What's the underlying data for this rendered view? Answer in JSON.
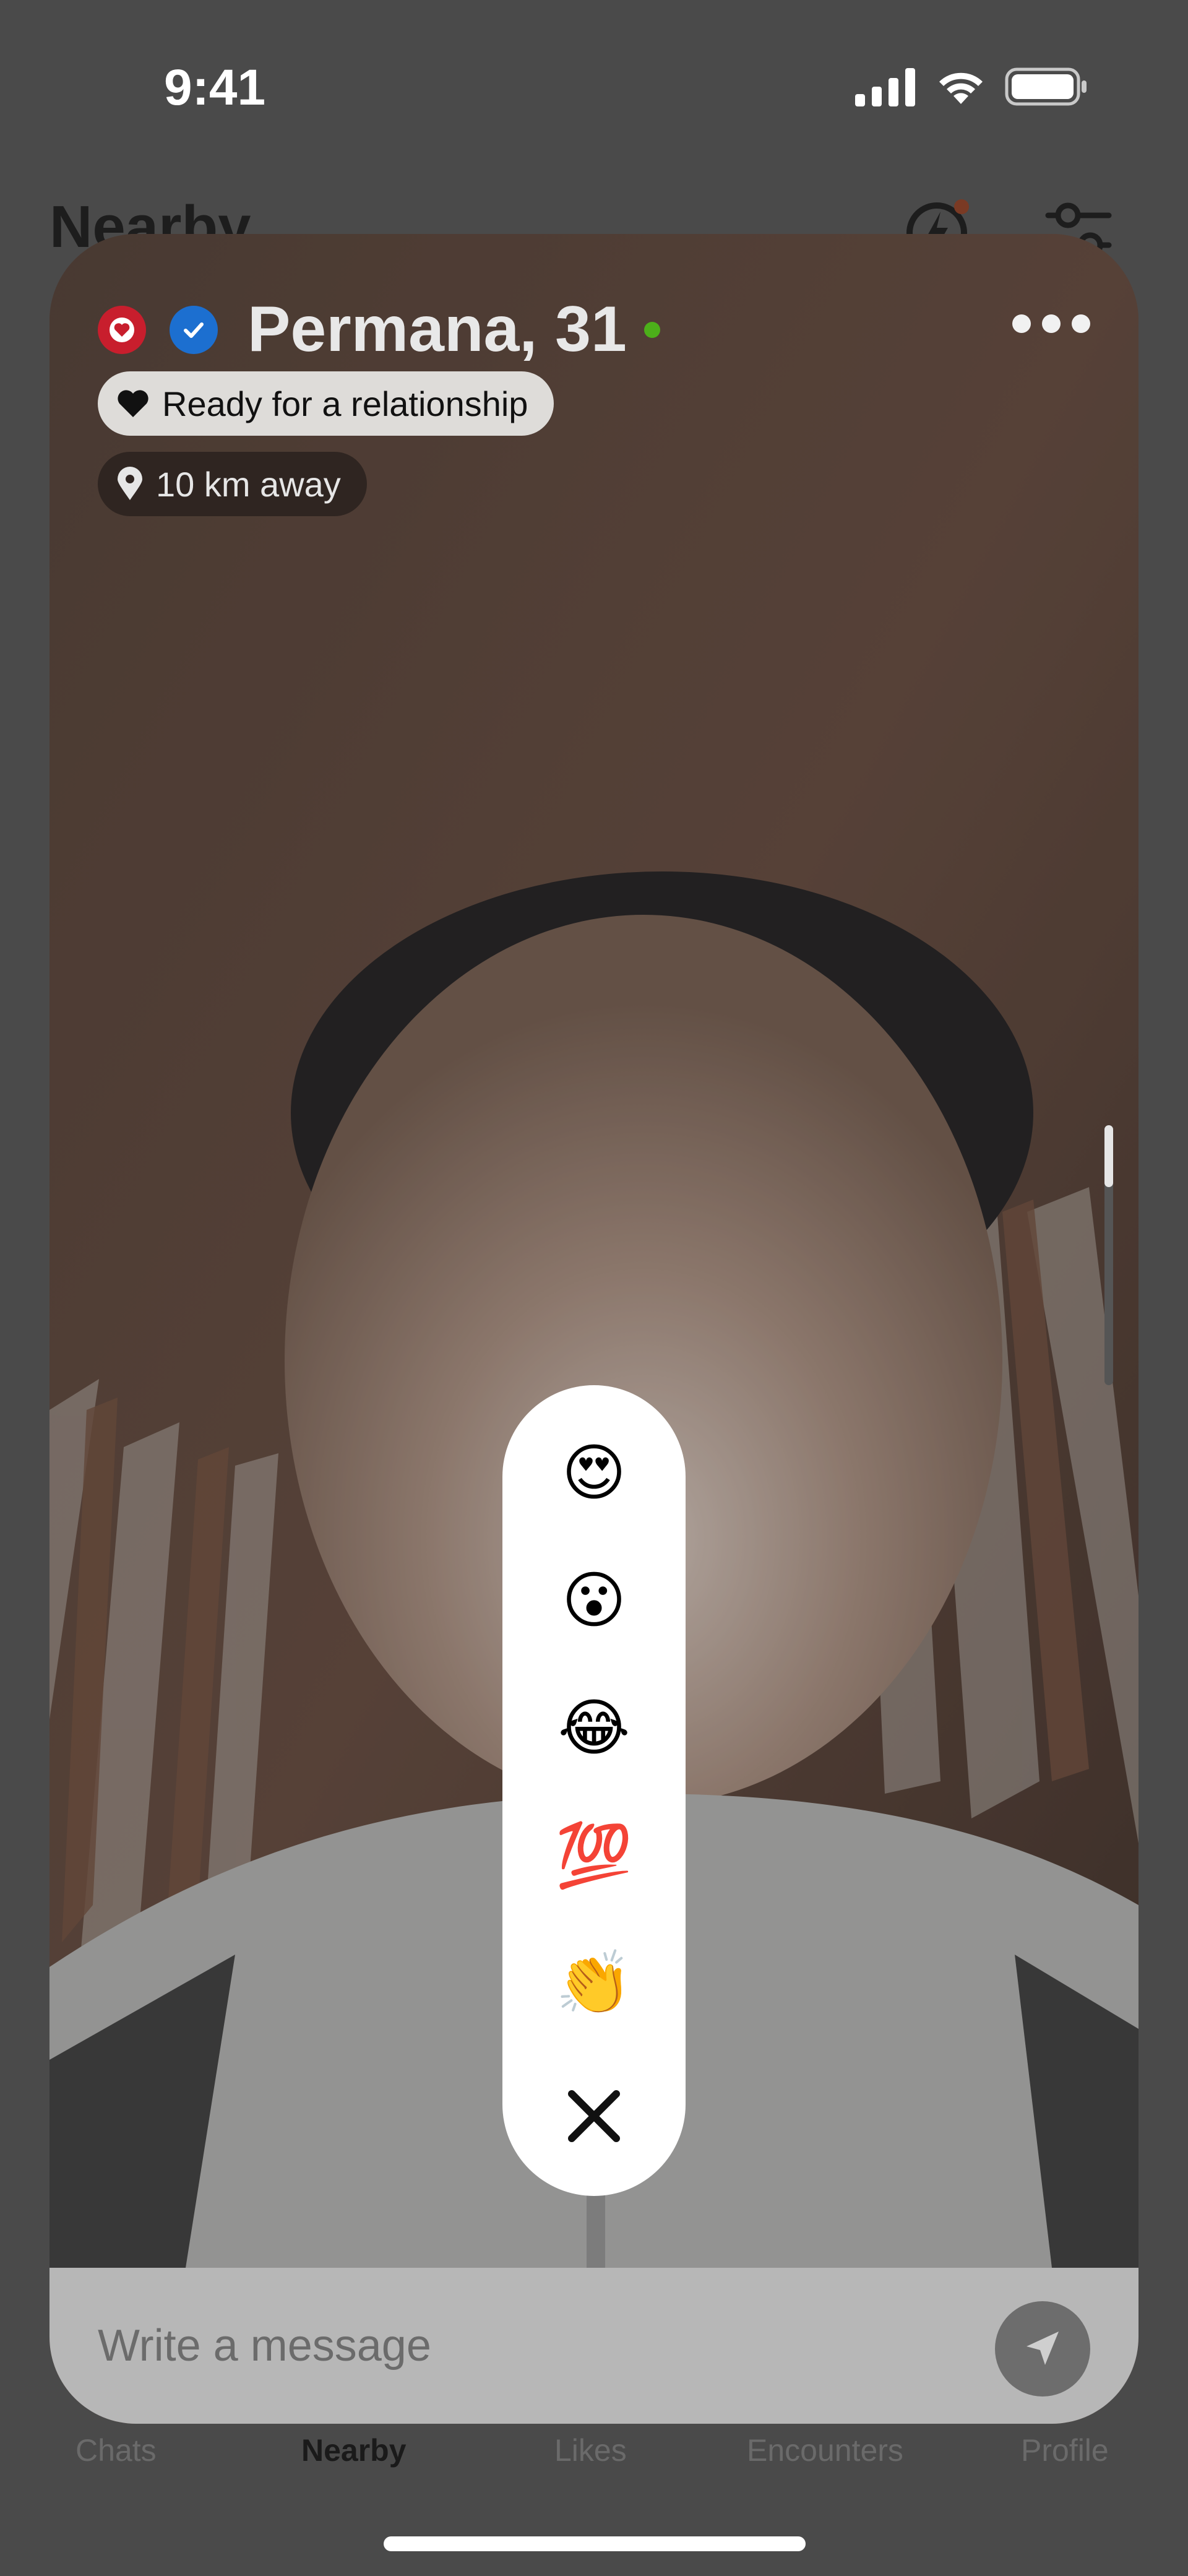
{
  "status_bar": {
    "time": "9:41"
  },
  "background_screen": {
    "title": "Nearby"
  },
  "profile": {
    "name_age": "Permana, 31",
    "relationship_goal": "Ready for a relationship",
    "distance": "10 km away"
  },
  "reactions": {
    "items": [
      {
        "emoji": "😍",
        "icon": "heart-eyes-emoji"
      },
      {
        "emoji": "😮",
        "icon": "surprised-face-emoji"
      },
      {
        "emoji": "😂",
        "icon": "tears-of-joy-emoji"
      },
      {
        "emoji": "💯",
        "icon": "hundred-points-emoji"
      },
      {
        "emoji": "👏",
        "icon": "clapping-hands-emoji"
      }
    ]
  },
  "message": {
    "placeholder": "Write a message"
  },
  "tabs": [
    {
      "label": "Chats"
    },
    {
      "label": "Nearby",
      "active": true
    },
    {
      "label": "Likes"
    },
    {
      "label": "Encounters"
    },
    {
      "label": "Profile"
    }
  ],
  "colors": {
    "online": "#4caf1a",
    "verified_badge": "#1c6fd0",
    "premium_badge": "#c81e2d",
    "dim_overlay": "#4a4a4a"
  }
}
